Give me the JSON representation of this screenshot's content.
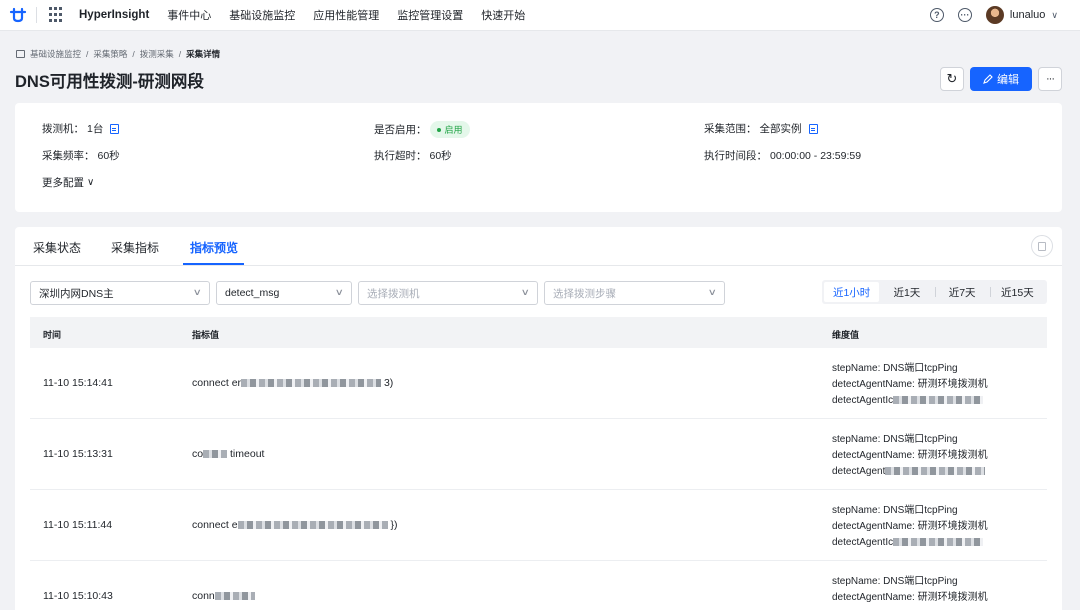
{
  "nav": {
    "brand": "HyperInsight",
    "items": [
      "事件中心",
      "基础设施监控",
      "应用性能管理",
      "监控管理设置",
      "快速开始"
    ],
    "help_icon": "question-circle-icon",
    "message_icon": "chat-icon",
    "user": "lunaluo"
  },
  "breadcrumb": [
    "基础设施监控",
    "采集策略",
    "拨测采集",
    "采集详情"
  ],
  "title": "DNS可用性拨测-研测网段",
  "actions": {
    "edit": "编辑",
    "more": "···",
    "refresh": "↻"
  },
  "info": {
    "probe_label": "拨测机：",
    "probe_value": "1台",
    "enabled_label": "是否启用：",
    "enabled_value": "启用",
    "scope_label": "采集范围：",
    "scope_value": "全部实例",
    "freq_label": "采集频率：",
    "freq_value": "60秒",
    "timeout_label": "执行超时：",
    "timeout_value": "60秒",
    "period_label": "执行时间段：",
    "period_value": "00:00:00 - 23:59:59",
    "more": "更多配置"
  },
  "tabs": [
    "采集状态",
    "采集指标",
    "指标预览"
  ],
  "active_tab": 2,
  "filters": {
    "target": "深圳内网DNS主",
    "metric": "detect_msg",
    "probe_placeholder": "选择拨测机",
    "step_placeholder": "选择拨测步骤"
  },
  "time_ranges": [
    "近1小时",
    "近1天",
    "近7天",
    "近15天"
  ],
  "table": {
    "columns": [
      "时间",
      "指标值",
      "维度值"
    ],
    "rows": [
      {
        "time": "11-10 15:14:41",
        "value_prefix": "connect er",
        "value_suffix": "3)",
        "dim1": "stepName: DNS端口tcpPing",
        "dim2": "detectAgentName: 研测环境拨测机",
        "dim3": "detectAgentIc"
      },
      {
        "time": "11-10 15:13:31",
        "value_prefix": "co",
        "value_suffix": "timeout",
        "dim1": "stepName: DNS端口tcpPing",
        "dim2": "detectAgentName: 研测环境拨测机",
        "dim3": "detectAgent"
      },
      {
        "time": "11-10 15:11:44",
        "value_prefix": "connect e",
        "value_suffix": "})",
        "dim1": "stepName: DNS端口tcpPing",
        "dim2": "detectAgentName: 研测环境拨测机",
        "dim3": "detectAgentIc"
      },
      {
        "time": "11-10 15:10:43",
        "value_prefix": "conn",
        "value_suffix": "",
        "dim1": "stepName: DNS端口tcpPing",
        "dim2": "detectAgentName: 研测环境拨测机",
        "dim3": ""
      }
    ]
  },
  "colors": {
    "primary": "#1664ff",
    "success": "#22a447"
  }
}
